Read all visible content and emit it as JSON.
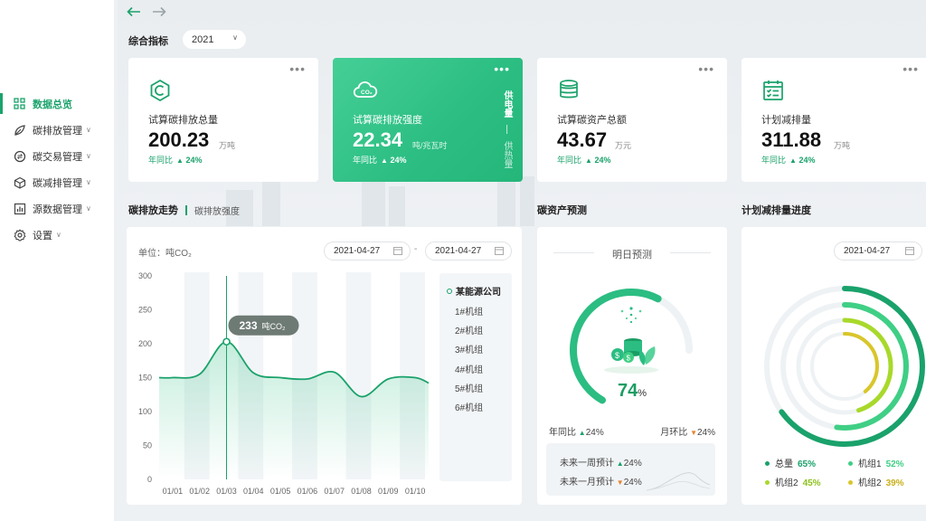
{
  "nav": {
    "back_icon": "arrow-left-icon",
    "forward_icon": "arrow-right-icon"
  },
  "sidebar": {
    "items": [
      {
        "label": "数据总览",
        "icon": "grid-icon",
        "active": true
      },
      {
        "label": "碳排放管理",
        "icon": "leaf-icon"
      },
      {
        "label": "碳交易管理",
        "icon": "exchange-icon"
      },
      {
        "label": "碳减排管理",
        "icon": "cube-icon"
      },
      {
        "label": "源数据管理",
        "icon": "bar-chart-icon"
      },
      {
        "label": "设置",
        "icon": "gear-icon"
      }
    ]
  },
  "overview": {
    "title": "综合指标",
    "year": "2021"
  },
  "kpis": [
    {
      "label": "试算碳排放总量",
      "value": "200.23",
      "unit": "万吨",
      "yoy_label": "年同比",
      "yoy": "24%",
      "icon": "carbon-c-icon"
    },
    {
      "label": "试算碳排放强度",
      "value": "22.34",
      "unit": "吨/兆瓦时",
      "yoy_label": "年同比",
      "yoy": "24%",
      "icon": "co2-cloud-icon",
      "tabs": [
        "供电量",
        "—",
        "供热量"
      ]
    },
    {
      "label": "试算碳资产总额",
      "value": "43.67",
      "unit": "万元",
      "yoy_label": "年同比",
      "yoy": "24%",
      "icon": "coin-stack-icon"
    },
    {
      "label": "计划减排量",
      "value": "311.88",
      "unit": "万吨",
      "yoy_label": "年同比",
      "yoy": "24%",
      "icon": "checklist-icon"
    }
  ],
  "emission": {
    "title": "碳排放走势",
    "subtitle": "碳排放强度",
    "unit_label": "单位：吨CO₂",
    "date_from": "2021-04-27",
    "date_sep": "-",
    "date_to": "2021-04-27",
    "tooltip_value": "233",
    "tooltip_unit": "吨CO₂",
    "legend": [
      "某能源公司",
      "1#机组",
      "2#机组",
      "3#机组",
      "4#机组",
      "5#机组",
      "6#机组"
    ]
  },
  "asset": {
    "title": "碳资产预测",
    "tomorrow": "明日预测",
    "percent": "74",
    "percent_unit": "%",
    "yoy_label": "年同比",
    "yoy": "24%",
    "mom_label": "月环比",
    "mom": "24%",
    "week_label": "未来一周预计",
    "week_value": "24%",
    "month_label": "未来一月预计",
    "month_value": "24%",
    "gauge_fraction": 0.74
  },
  "plan": {
    "title": "计划减排量进度",
    "date": "2021-04-27",
    "legend": [
      {
        "label": "总量",
        "value": "65%",
        "color": "#1aa26b"
      },
      {
        "label": "机组1",
        "value": "52%",
        "color": "#3fcf85"
      },
      {
        "label": "机组2",
        "value": "45%",
        "color": "#a8d92a"
      },
      {
        "label": "机组2",
        "value": "39%",
        "color": "#d9c62a"
      }
    ]
  },
  "chart_data": {
    "type": "area",
    "categories": [
      "01/01",
      "01/02",
      "01/03",
      "01/04",
      "01/05",
      "01/06",
      "01/07",
      "01/08",
      "01/09",
      "01/10"
    ],
    "xlabel": "",
    "ylabel": "",
    "ylim": [
      0,
      300
    ],
    "yticks": [
      0,
      50,
      100,
      150,
      200,
      250,
      300
    ],
    "series": [
      {
        "name": "某能源公司",
        "values": [
          150,
          155,
          203,
          157,
          150,
          148,
          158,
          122,
          148,
          150
        ]
      }
    ],
    "highlight": {
      "category": "01/03",
      "value": 233,
      "label": "233 吨CO₂"
    },
    "grid": true,
    "legend": "right"
  }
}
